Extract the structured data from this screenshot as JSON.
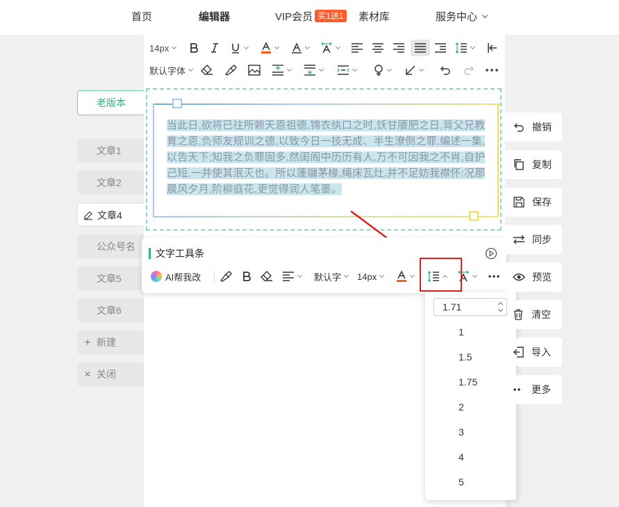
{
  "nav": {
    "items": [
      {
        "label": "首页"
      },
      {
        "label": "编辑器"
      },
      {
        "label": "VIP会员",
        "badge": "买1送1"
      },
      {
        "label": "素材库"
      },
      {
        "label": "服务中心"
      }
    ]
  },
  "left": {
    "old_version": "老版本",
    "articles": [
      "文章1",
      "文章2",
      "文章4",
      "公众号名",
      "文章5",
      "文章6"
    ],
    "new_label": "新建",
    "close_label": "关闭"
  },
  "toolbar": {
    "font_size": "14px",
    "font_family": "默认字体"
  },
  "content": {
    "text": "当此日,欲将已往所赖天恩祖德,锦衣纨口之时,饫甘餍肥之日,背父兄教育之恩,负师友规训之德,以致今日一技无成、半生潦倒之罪,编述一集,以告天下;知我之负罪固多,然闺阁中历历有人,万不可因我之不肖,自护己短,一并使其泯灭也。所以蓬牖茅椽,绳床瓦灶,并不足妨我襟怀:况那晨风夕月,阶柳庭花,更觉得润人笔墨。"
  },
  "floatbar": {
    "title": "文字工具条",
    "ai_label": "AI帮我改",
    "font_family": "默认字",
    "font_size": "14px"
  },
  "line_height": {
    "value": "1.71",
    "options": [
      "1",
      "1.5",
      "1.75",
      "2",
      "3",
      "4",
      "5"
    ]
  },
  "right": {
    "buttons": [
      "撤销",
      "复制",
      "保存",
      "同步",
      "预览",
      "清空",
      "导入",
      "更多"
    ]
  },
  "colors": {
    "accent": "#2fb584",
    "font_color_bar": "#ff5a1f",
    "highlight": "#e02020"
  }
}
